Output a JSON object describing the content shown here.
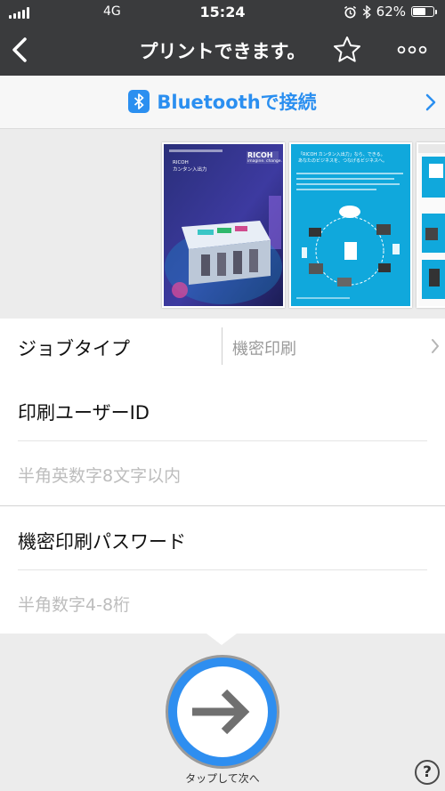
{
  "status_bar": {
    "carrier": "4G",
    "time": "15:24",
    "battery_text": "62%",
    "battery_level": 0.62
  },
  "nav": {
    "title": "プリントできます。"
  },
  "bluetooth": {
    "label": "Bluetoothで接続"
  },
  "preview": {
    "page1": {
      "brand": "RICOH",
      "tagline": "imagine. change.",
      "heading": "RICOH\nカンタン入出力"
    },
    "page2": {
      "heading": "「RICOH カンタン入出力」なら、できる。\nあなたのビジネスを、つなげるビジネスへ。"
    }
  },
  "form": {
    "job_type": {
      "label": "ジョブタイプ",
      "value": "機密印刷"
    },
    "user_id": {
      "label": "印刷ユーザーID",
      "placeholder": "半角英数字8文字以内"
    },
    "password": {
      "label": "機密印刷パスワード",
      "placeholder": "半角数字4-8桁"
    }
  },
  "next": {
    "label": "タップして次へ"
  },
  "help": {
    "label": "?"
  },
  "colors": {
    "accent": "#2b8ff0",
    "nav_bg": "#3a3b3d"
  }
}
